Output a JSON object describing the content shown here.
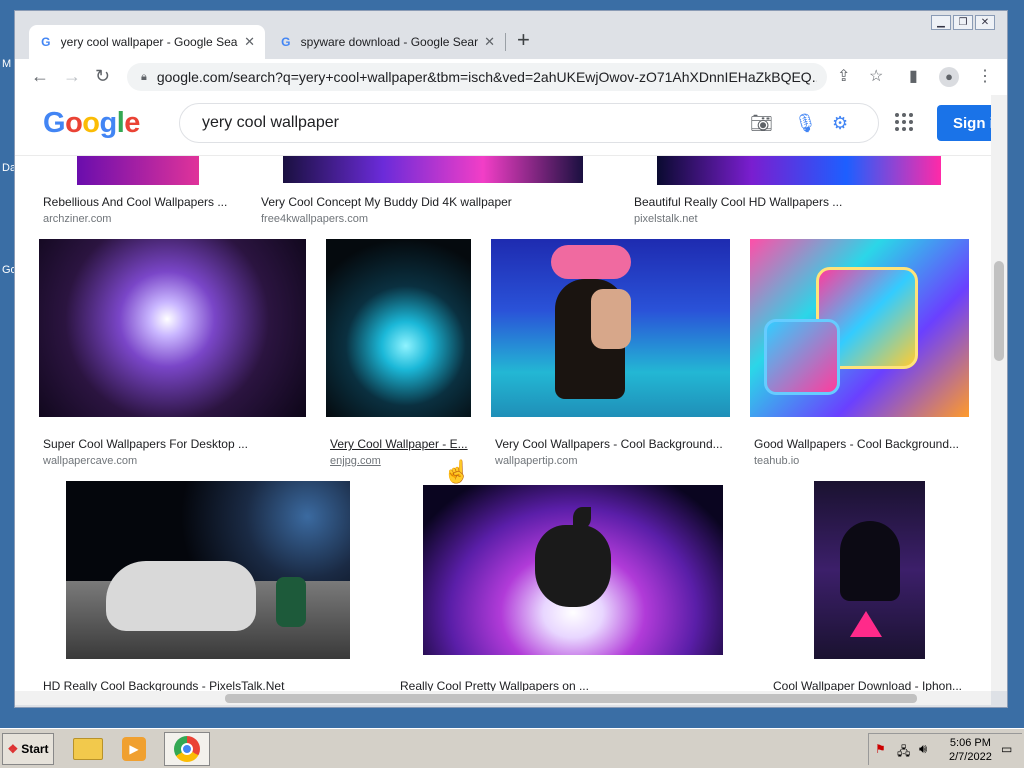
{
  "desktop": {
    "labels": [
      "M",
      "Da",
      "Go"
    ]
  },
  "tabs": [
    {
      "title": "yery cool wallpaper - Google Search",
      "active": true
    },
    {
      "title": "spyware download - Google Search",
      "active": false
    }
  ],
  "address_bar": {
    "url": "google.com/search?q=yery+cool+wallpaper&tbm=isch&ved=2ahUKEwjOwov-zO71AhXDnnIEHaZkBQEQ..."
  },
  "google": {
    "logo": "Google",
    "search_value": "yery cool wallpaper",
    "sign_in": "Sign in"
  },
  "results_top": [
    {
      "caption": "Rebellious And Cool Wallpapers ...",
      "source": "archziner.com"
    },
    {
      "caption": "Very Cool Concept My Buddy Did 4K wallpaper",
      "source": "free4kwallpapers.com"
    },
    {
      "caption": "Beautiful Really Cool HD Wallpapers ...",
      "source": "pixelstalk.net"
    }
  ],
  "results_mid": [
    {
      "caption": "Super Cool Wallpapers For Desktop ...",
      "source": "wallpapercave.com"
    },
    {
      "caption": "Very Cool Wallpaper - E...",
      "source": "enjpg.com"
    },
    {
      "caption": "Very Cool Wallpapers - Cool Background...",
      "source": "wallpapertip.com"
    },
    {
      "caption": "Good Wallpapers - Cool Background...",
      "source": "teahub.io"
    }
  ],
  "results_bottom": [
    {
      "caption": "HD Really Cool Backgrounds - PixelsTalk.Net"
    },
    {
      "caption": "Really Cool Pretty Wallpapers on ..."
    },
    {
      "caption": "Cool Wallpaper Download - Iphon..."
    }
  ],
  "taskbar": {
    "start_label": "Start",
    "time": "5:06 PM",
    "date": "2/7/2022"
  },
  "colors": {
    "accent": "#1a73e8",
    "desktop": "#3a6ea5"
  }
}
